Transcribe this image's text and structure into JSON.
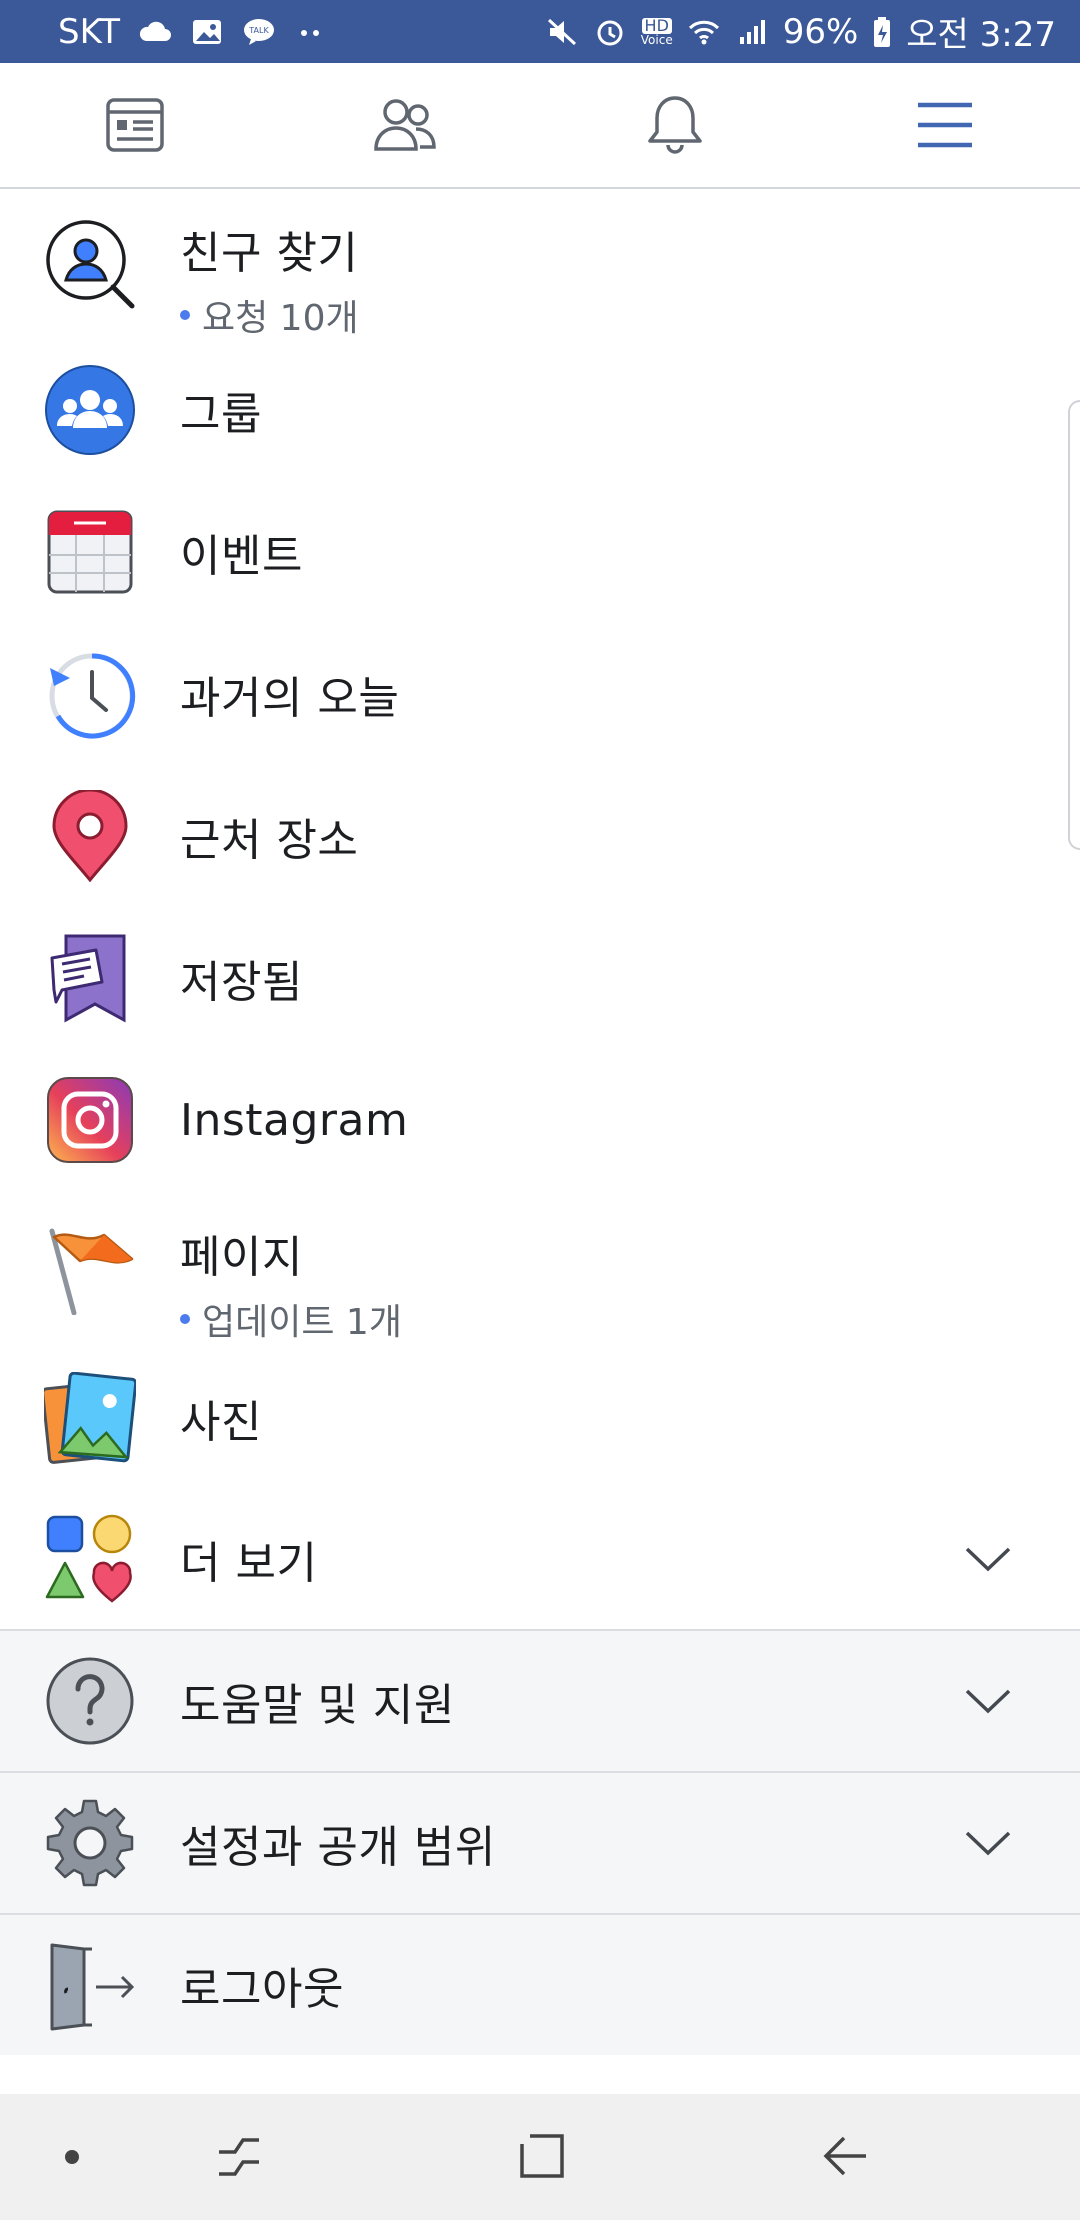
{
  "status_bar": {
    "carrier": "SKT",
    "left_icons": [
      "cloud-icon",
      "image-icon",
      "talk-icon",
      "more-dots-icon"
    ],
    "hd_label": "HD",
    "voice_label": "Voice",
    "battery": "96%",
    "time": "오전 3:27"
  },
  "top_nav": {
    "tabs": [
      {
        "name": "news-feed-icon"
      },
      {
        "name": "friends-icon"
      },
      {
        "name": "notifications-icon"
      },
      {
        "name": "menu-icon",
        "active": true
      }
    ],
    "accent": "#4267b2"
  },
  "menu": {
    "items": [
      {
        "label": "친구 찾기",
        "sub": "요청 10개",
        "icon": "find-friends-icon"
      },
      {
        "label": "그룹",
        "icon": "groups-icon"
      },
      {
        "label": "이벤트",
        "icon": "events-icon"
      },
      {
        "label": "과거의 오늘",
        "icon": "memories-icon"
      },
      {
        "label": "근처 장소",
        "icon": "nearby-places-icon"
      },
      {
        "label": "저장됨",
        "icon": "saved-icon"
      },
      {
        "label": "Instagram",
        "icon": "instagram-icon"
      },
      {
        "label": "페이지",
        "sub": "업데이트 1개",
        "icon": "pages-icon"
      },
      {
        "label": "사진",
        "icon": "photos-icon"
      },
      {
        "label": "더 보기",
        "icon": "see-more-icon",
        "expandable": true
      }
    ],
    "sections": [
      {
        "label": "도움말 및 지원",
        "icon": "help-icon",
        "expandable": true
      },
      {
        "label": "설정과 공개 범위",
        "icon": "settings-icon",
        "expandable": true
      },
      {
        "label": "로그아웃",
        "icon": "logout-icon"
      }
    ]
  },
  "nav_bar": {
    "buttons": [
      "home-dot-icon",
      "recents-icon",
      "overview-icon",
      "back-icon"
    ]
  }
}
